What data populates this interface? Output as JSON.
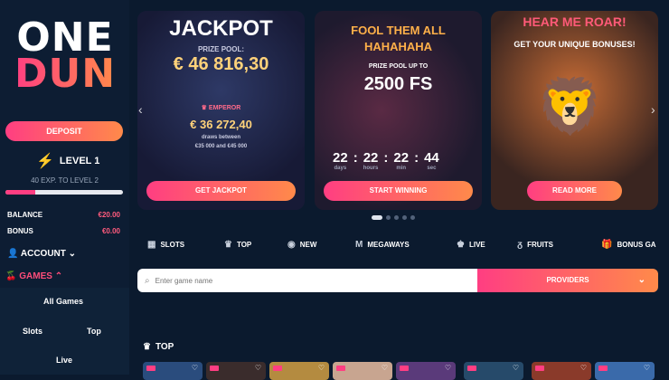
{
  "brand": {
    "line1": "ONE",
    "line2": "DUN"
  },
  "sidebar": {
    "deposit_label": "DEPOSIT",
    "level_label": "LEVEL 1",
    "exp_text": "40 EXP. TO LEVEL 2",
    "exp_progress": 0.25,
    "balance_label": "BALANCE",
    "balance_value": "€20.00",
    "bonus_label": "BONUS",
    "bonus_value": "€0.00",
    "account_label": "ACCOUNT",
    "games_label": "GAMES",
    "categories": [
      "All Games",
      "Slots",
      "Top",
      "Live"
    ]
  },
  "banners": [
    {
      "title": "JACKPOT",
      "subtitle": "PRIZE POOL:",
      "amount": "€ 46 816,30",
      "tag": "EMPEROR",
      "sub_amount": "€ 36 272,40",
      "draws_label": "draws between",
      "draws_range": "€35 000 and €45 000",
      "button": "GET JACKPOT"
    },
    {
      "title_line1": "FOOL THEM ALL",
      "title_line2": "HAHAHAHA",
      "pool_label": "PRIZE POOL UP TO",
      "pool_value": "2500 FS",
      "countdown": [
        {
          "value": "22",
          "unit": "days"
        },
        {
          "value": "22",
          "unit": "hours"
        },
        {
          "value": "22",
          "unit": "min"
        },
        {
          "value": "44",
          "unit": "sec"
        }
      ],
      "button": "START WINNING"
    },
    {
      "title": "HEAR ME ROAR!",
      "subtitle": "GET YOUR UNIQUE BONUSES!",
      "button": "READ MORE"
    }
  ],
  "tabs": [
    {
      "label": "SLOTS",
      "icon": "slots-icon"
    },
    {
      "label": "TOP",
      "icon": "crown-icon"
    },
    {
      "label": "NEW",
      "icon": "new-icon"
    },
    {
      "label": "MEGAWAYS",
      "icon": "megaways-icon"
    },
    {
      "label": "LIVE",
      "icon": "live-icon"
    },
    {
      "label": "FRUITS",
      "icon": "fruits-icon"
    },
    {
      "label": "BONUS GA",
      "icon": "bonus-icon"
    }
  ],
  "search": {
    "placeholder": "Enter game name",
    "providers_label": "PROVIDERS"
  },
  "section": {
    "title": "TOP"
  },
  "colors": {
    "accent": "#ff3e82",
    "accent2": "#ff8a4a",
    "bg": "#0b1a2e"
  }
}
